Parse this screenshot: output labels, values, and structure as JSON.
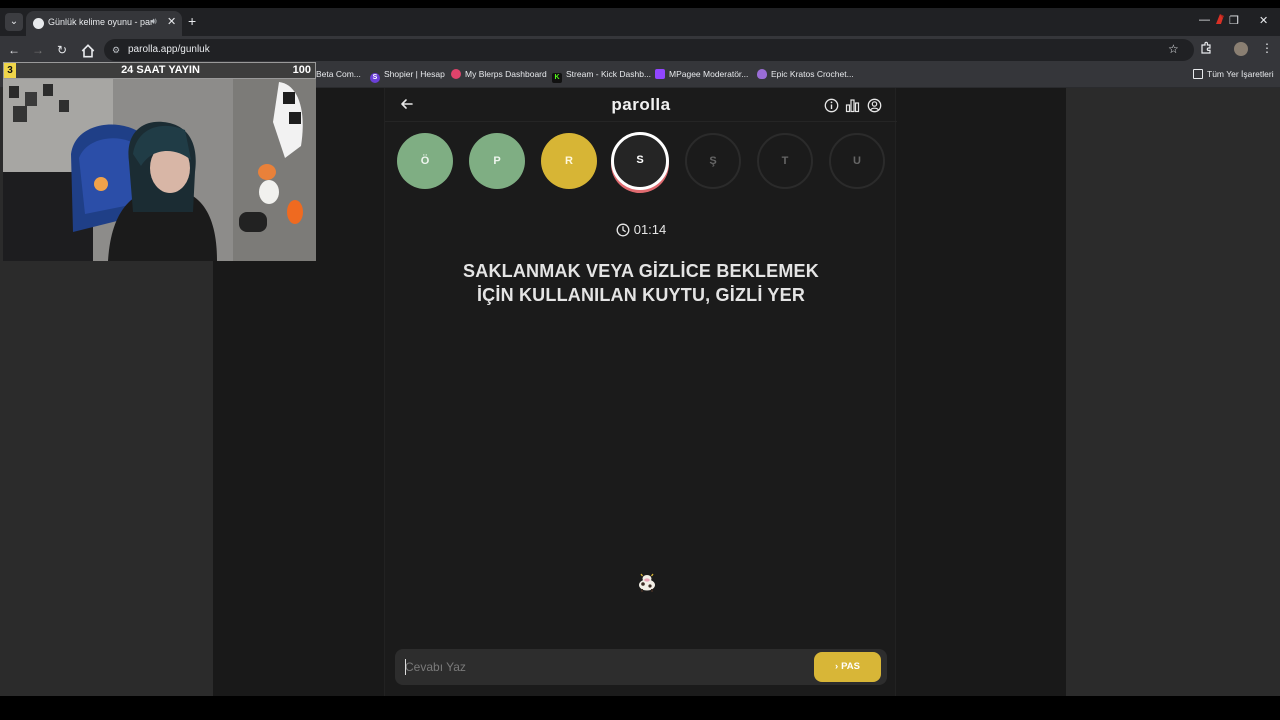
{
  "browser": {
    "tab_title": "Günlük kelime oyunu - parolla",
    "tab_close": "✕",
    "new_tab": "+",
    "url": "parolla.app/gunluk",
    "bookmarks": [
      {
        "label": "Beta Com...",
        "color": "#8a8a8a",
        "glyph": ""
      },
      {
        "label": "Shopier | Hesap",
        "color": "#6b3fd8",
        "glyph": "S"
      },
      {
        "label": "My Blerps Dashboard",
        "color": "#e0436b",
        "glyph": ""
      },
      {
        "label": "Stream - Kick Dashb...",
        "color": "#53fc18",
        "glyph": "K"
      },
      {
        "label": "MPagee Moderatör...",
        "color": "#9146ff",
        "glyph": ""
      },
      {
        "label": "Epic Kratos Crochet...",
        "color": "#9a6dd6",
        "glyph": ""
      }
    ],
    "all_bookmarks": "Tüm Yer İşaretleri"
  },
  "stream_overlay": {
    "left_number": "3",
    "title": "24 SAAT YAYIN",
    "right_number": "100"
  },
  "app": {
    "brand": "parolla",
    "letters": [
      {
        "char": "Ö",
        "state": "correct"
      },
      {
        "char": "P",
        "state": "correct"
      },
      {
        "char": "R",
        "state": "passed"
      },
      {
        "char": "S",
        "state": "current"
      },
      {
        "char": "Ş",
        "state": "pending"
      },
      {
        "char": "T",
        "state": "pending"
      },
      {
        "char": "U",
        "state": "pending"
      }
    ],
    "timer": "01:14",
    "question_line1": "SAKLANMAK VEYA GİZLİCE BEKLEMEK",
    "question_line2": "İÇİN KULLANILAN KUYTU, GİZLİ YER",
    "answer_placeholder": "Cevabı Yaz",
    "pas_label": "PAS"
  },
  "colors": {
    "correct": "#7fae83",
    "passed": "#d7b535",
    "current_ring": "#ffffff",
    "accent_red": "#e06b70"
  }
}
